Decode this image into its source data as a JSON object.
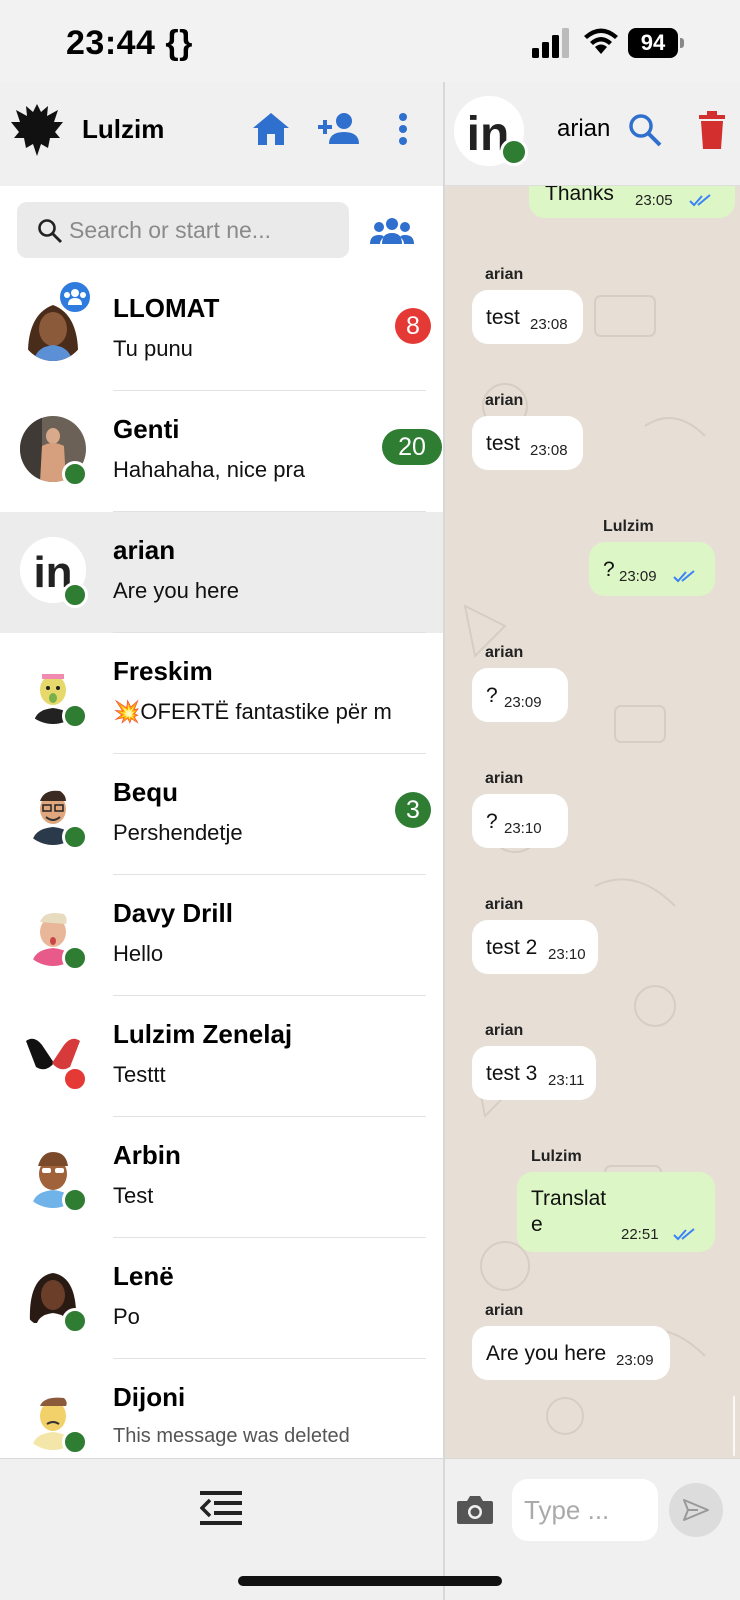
{
  "status_bar": {
    "time": "23:44 {}",
    "battery": "94"
  },
  "left_panel": {
    "header": {
      "username": "Lulzim",
      "icons": [
        "eagle-logo",
        "home-icon",
        "add-person-icon",
        "more-vert-icon"
      ]
    },
    "search": {
      "placeholder": "Search or start ne..."
    },
    "chats": [
      {
        "name": "LLOMAT",
        "last_message": "Tu punu",
        "unread": "8",
        "unread_color": "#e53935",
        "group": true,
        "online_color": ""
      },
      {
        "name": "Genti",
        "last_message": "Hahahaha, nice pra",
        "unread": "20",
        "unread_color": "#2e7d32",
        "online_color": "#2e7d32"
      },
      {
        "name": "arian",
        "last_message": "Are you here",
        "unread": "",
        "online_color": "#2e7d32",
        "selected": true
      },
      {
        "name": "Freskim",
        "last_message": "💥OFERTË fantastike për m",
        "unread": "",
        "online_color": "#2e7d32"
      },
      {
        "name": "Bequ",
        "last_message": "Pershendetje",
        "unread": "3",
        "unread_color": "#2e7d32",
        "online_color": "#2e7d32"
      },
      {
        "name": "Davy Drill",
        "last_message": "Hello",
        "unread": "",
        "online_color": "#2e7d32"
      },
      {
        "name": "Lulzim Zenelaj",
        "last_message": "Testtt",
        "unread": "",
        "online_color": "#e53935"
      },
      {
        "name": "Arbin",
        "last_message": "Test",
        "unread": "",
        "online_color": "#2e7d32"
      },
      {
        "name": "Lenë",
        "last_message": "Po",
        "unread": "",
        "online_color": "#2e7d32"
      },
      {
        "name": "Dijoni",
        "last_message": "This message was deleted",
        "unread": "",
        "online_color": "#2e7d32",
        "deleted": true
      }
    ]
  },
  "right_panel": {
    "header": {
      "contact_name": "arian"
    },
    "messages": [
      {
        "sender": "",
        "text": "Thanks",
        "time": "23:05",
        "dir": "out"
      },
      {
        "sender": "arian",
        "text": "test",
        "time": "23:08",
        "dir": "in"
      },
      {
        "sender": "arian",
        "text": "test",
        "time": "23:08",
        "dir": "in"
      },
      {
        "sender": "Lulzim",
        "text": "?",
        "time": "23:09",
        "dir": "out"
      },
      {
        "sender": "arian",
        "text": "?",
        "time": "23:09",
        "dir": "in"
      },
      {
        "sender": "arian",
        "text": "?",
        "time": "23:10",
        "dir": "in"
      },
      {
        "sender": "arian",
        "text": "test 2",
        "time": "23:10",
        "dir": "in"
      },
      {
        "sender": "arian",
        "text": "test 3",
        "time": "23:11",
        "dir": "in"
      },
      {
        "sender": "Lulzim",
        "text": "Translat\ne",
        "time": "22:51",
        "dir": "out"
      },
      {
        "sender": "arian",
        "text": "Are you here",
        "time": "23:09",
        "dir": "in"
      }
    ],
    "composer": {
      "placeholder": "Type ..."
    }
  },
  "colors": {
    "accent": "#2f6fce",
    "online": "#2e7d32",
    "delete": "#d32f2f",
    "out_bubble": "#dcf7c5",
    "chat_bg": "#e7dfd6"
  }
}
